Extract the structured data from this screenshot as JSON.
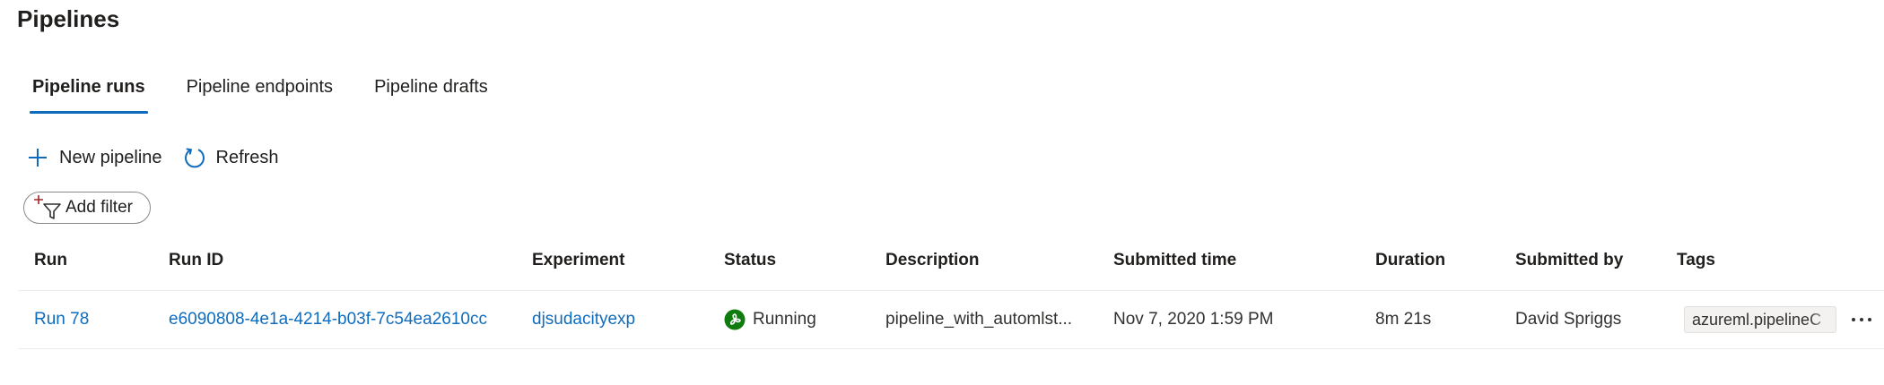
{
  "page": {
    "title": "Pipelines"
  },
  "tabs": [
    {
      "label": "Pipeline runs",
      "active": true
    },
    {
      "label": "Pipeline endpoints",
      "active": false
    },
    {
      "label": "Pipeline drafts",
      "active": false
    }
  ],
  "toolbar": {
    "new_pipeline_label": "New pipeline",
    "new_pipeline_icon": "plus-icon",
    "refresh_label": "Refresh",
    "refresh_icon": "refresh-icon"
  },
  "filter": {
    "add_filter_label": "Add filter",
    "icon": "add-filter-icon"
  },
  "table": {
    "columns": [
      "Run",
      "Run ID",
      "Experiment",
      "Status",
      "Description",
      "Submitted time",
      "Duration",
      "Submitted by",
      "Tags"
    ],
    "rows": [
      {
        "run": "Run 78",
        "run_id": "e6090808-4e1a-4214-b03f-7c54ea2610cc",
        "experiment": "djsudacityexp",
        "status": "Running",
        "status_icon": "running-icon",
        "description": "pipeline_with_automlst...",
        "submitted_time": "Nov 7, 2020 1:59 PM",
        "duration": "8m 21s",
        "submitted_by": "David Spriggs",
        "tags": "azureml.pipelineC"
      }
    ]
  },
  "colors": {
    "accent": "#0f6cbd",
    "running_green": "#107c10",
    "text": "#201f1e",
    "border": "#edebe9"
  }
}
